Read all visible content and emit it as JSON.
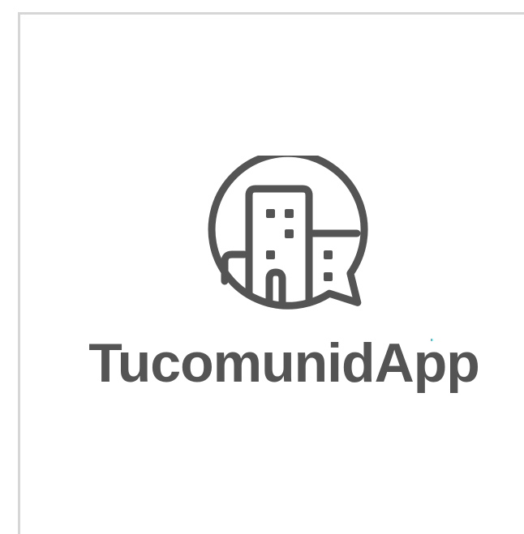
{
  "brand": {
    "name": "TucomunidApp",
    "text_color": "#545454",
    "icon_color": "#545454",
    "accent_color": "#3fc7d6"
  },
  "icon": {
    "name": "city-chat-bubble-icon"
  }
}
